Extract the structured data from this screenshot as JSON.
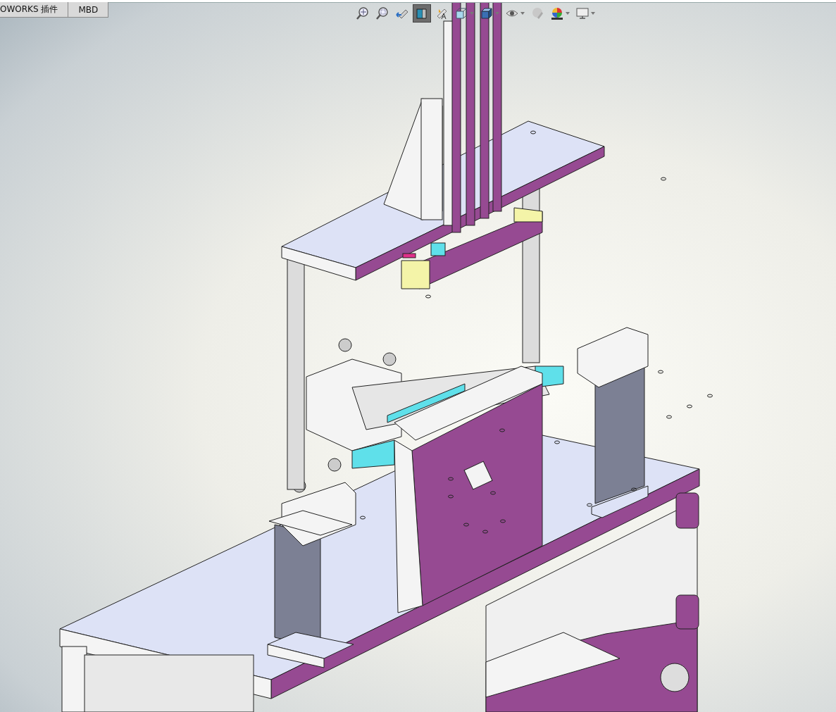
{
  "tabs": [
    {
      "label": "OWORKS 插件",
      "selected": false
    },
    {
      "label": "MBD",
      "selected": false
    }
  ],
  "view_toolbar": [
    {
      "kind": "zoom-fit",
      "active": false,
      "dropdown": false
    },
    {
      "kind": "zoom-area",
      "active": false,
      "dropdown": false
    },
    {
      "kind": "previous-view",
      "active": false,
      "dropdown": false
    },
    {
      "kind": "section-view",
      "active": true,
      "dropdown": false
    },
    {
      "kind": "annotation-view",
      "active": false,
      "dropdown": false
    },
    {
      "kind": "view-orientation",
      "active": false,
      "dropdown": true
    },
    {
      "kind": "display-style",
      "active": false,
      "dropdown": true
    },
    {
      "kind": "hide-show",
      "active": false,
      "dropdown": true
    },
    {
      "kind": "edit-appearance",
      "active": false,
      "dropdown": false
    },
    {
      "kind": "scene",
      "active": false,
      "dropdown": true
    },
    {
      "kind": "display-settings",
      "active": false,
      "dropdown": true
    }
  ]
}
